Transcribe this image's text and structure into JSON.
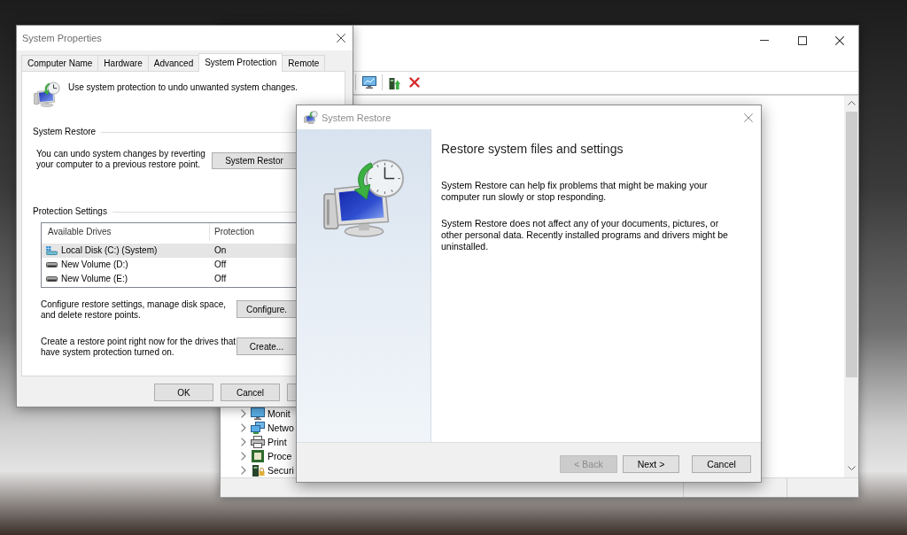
{
  "device_manager": {
    "tree": [
      {
        "label": "Monit",
        "kind": "monitor",
        "expanded": false
      },
      {
        "label": "Netwo",
        "kind": "network",
        "expanded": false
      },
      {
        "label": "Print",
        "kind": "printer",
        "expanded": false
      },
      {
        "label": "Proce",
        "kind": "processor",
        "expanded": false
      },
      {
        "label": "Securi",
        "kind": "security",
        "expanded": false
      }
    ]
  },
  "system_properties": {
    "title": "System Properties",
    "tabs": [
      {
        "label": "Computer Name",
        "selected": false
      },
      {
        "label": "Hardware",
        "selected": false
      },
      {
        "label": "Advanced",
        "selected": false
      },
      {
        "label": "System Protection",
        "selected": true
      },
      {
        "label": "Remote",
        "selected": false
      }
    ],
    "intro": "Use system protection to undo unwanted system changes.",
    "restore_group": {
      "label": "System Restore",
      "text": "You can undo system changes by reverting\nyour computer to a previous restore point.",
      "button": "System Restor"
    },
    "protection_group": {
      "label": "Protection Settings",
      "columns": [
        "Available Drives",
        "Protection"
      ],
      "drives": [
        {
          "name": "Local Disk (C:) (System)",
          "protection": "On",
          "selected": true,
          "kind": "system"
        },
        {
          "name": "New Volume (D:)",
          "protection": "Off",
          "selected": false,
          "kind": "volume"
        },
        {
          "name": "New Volume (E:)",
          "protection": "Off",
          "selected": false,
          "kind": "volume"
        }
      ],
      "configure": {
        "text": "Configure restore settings, manage disk space,\nand delete restore points.",
        "button": "Configure."
      },
      "create": {
        "text": "Create a restore point right now for the drives that\nhave system protection turned on.",
        "button": "Create..."
      }
    },
    "buttons": [
      "OK",
      "Cancel"
    ]
  },
  "system_restore": {
    "title": "System Restore",
    "heading": "Restore system files and settings",
    "paragraphs": [
      "System Restore can help fix problems that might be making your\ncomputer run slowly or stop responding.",
      "System Restore does not affect any of your documents, pictures, or\nother personal data. Recently installed programs and drivers might be\nuninstalled."
    ],
    "buttons": [
      {
        "label": "< Back",
        "disabled": true
      },
      {
        "label": "Next >",
        "disabled": false
      },
      {
        "label": "Cancel",
        "disabled": false
      }
    ]
  }
}
